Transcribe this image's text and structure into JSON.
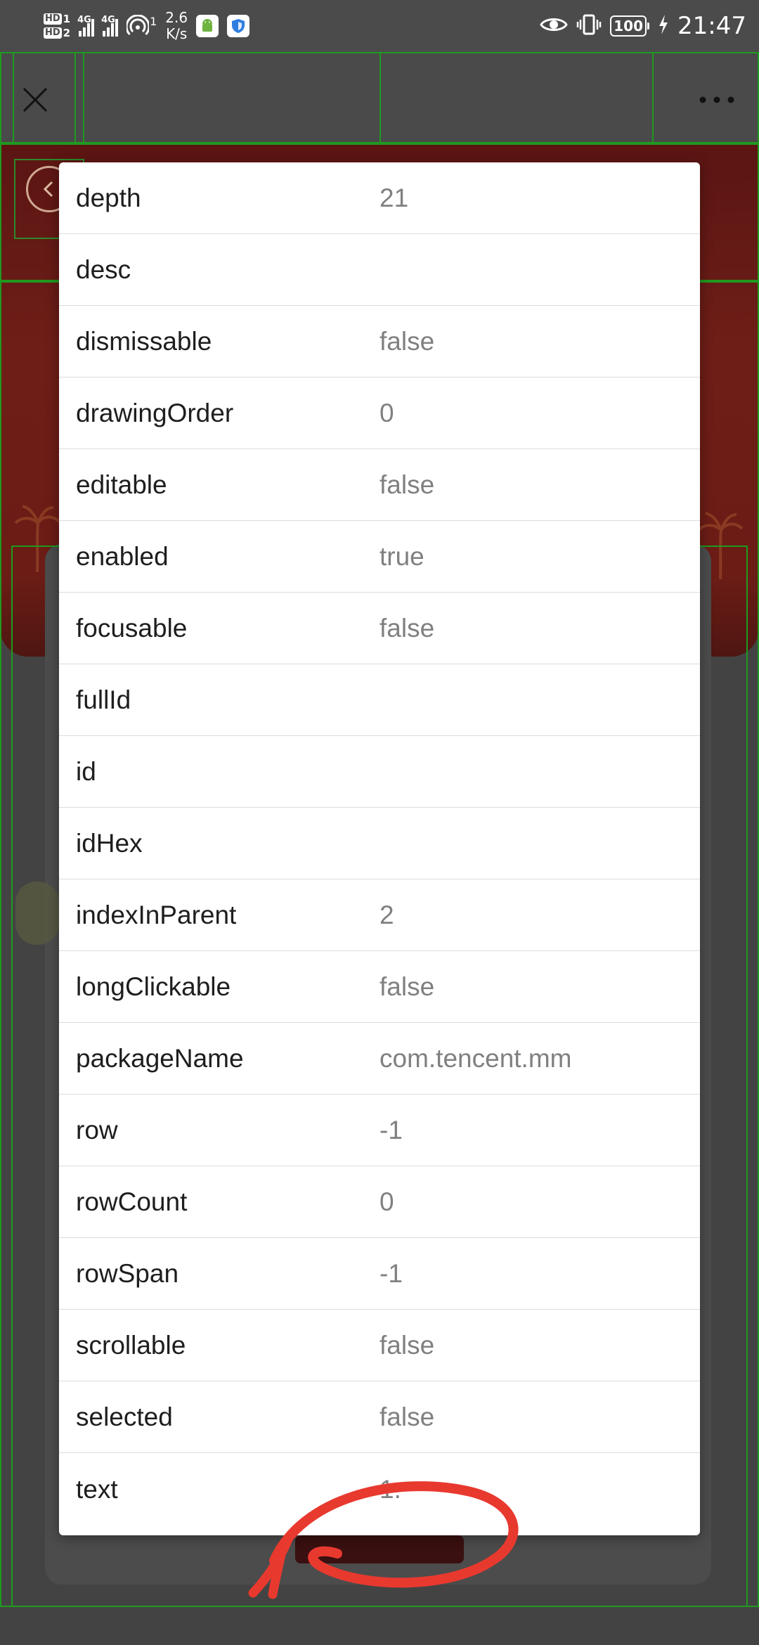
{
  "status_bar": {
    "sim1_badge": "HD",
    "sim1_slot": "1",
    "sim2_badge": "HD",
    "sim2_slot": "2",
    "network_1": "4G",
    "network_2": "4G",
    "hotspot_count": "1",
    "speed_value": "2.6",
    "speed_unit": "K/s",
    "battery": "100",
    "time": "21:47"
  },
  "properties": [
    {
      "key": "depth",
      "value": "21"
    },
    {
      "key": "desc",
      "value": ""
    },
    {
      "key": "dismissable",
      "value": "false"
    },
    {
      "key": "drawingOrder",
      "value": "0"
    },
    {
      "key": "editable",
      "value": "false"
    },
    {
      "key": "enabled",
      "value": "true"
    },
    {
      "key": "focusable",
      "value": "false"
    },
    {
      "key": "fullId",
      "value": ""
    },
    {
      "key": "id",
      "value": ""
    },
    {
      "key": "idHex",
      "value": ""
    },
    {
      "key": "indexInParent",
      "value": "2"
    },
    {
      "key": "longClickable",
      "value": "false"
    },
    {
      "key": "packageName",
      "value": "com.tencent.mm"
    },
    {
      "key": "row",
      "value": "-1"
    },
    {
      "key": "rowCount",
      "value": "0"
    },
    {
      "key": "rowSpan",
      "value": "-1"
    },
    {
      "key": "scrollable",
      "value": "false"
    },
    {
      "key": "selected",
      "value": "false"
    },
    {
      "key": "text",
      "value": "1."
    }
  ],
  "colors": {
    "annotation": "#e8392f",
    "inspector_outline": "#1f9a1f",
    "banner": "#6e1e17"
  },
  "icons": {
    "close": "close-icon",
    "more": "more-dots-icon",
    "back": "back-arrow-icon"
  }
}
